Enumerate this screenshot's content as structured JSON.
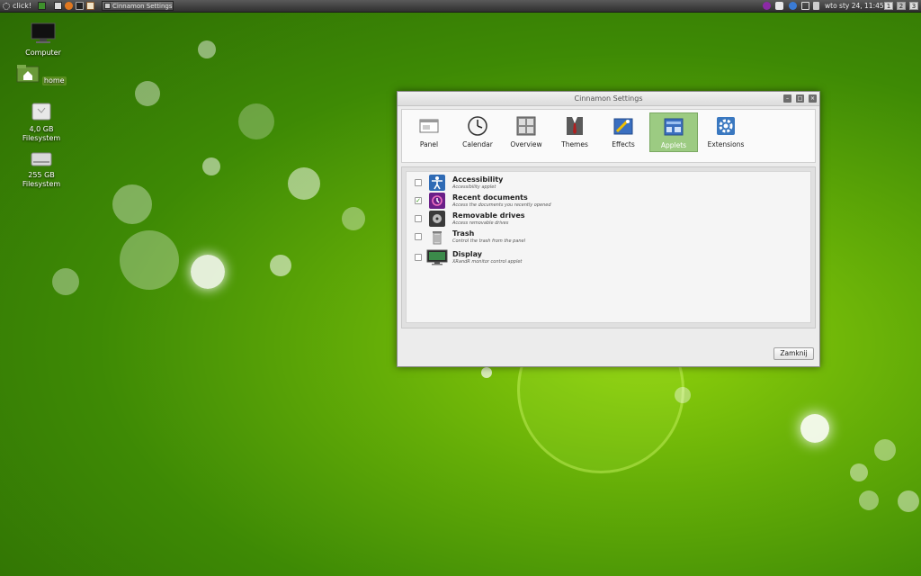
{
  "panel": {
    "menu_label": "click!",
    "taskbar_window": "Cinnamon Settings",
    "clock": "wto sty 24, 11:45",
    "workspaces": [
      "1",
      "2",
      "3"
    ],
    "active_workspace": "2"
  },
  "desktop": {
    "icons": [
      {
        "label": "Computer",
        "icon": "monitor-icon"
      },
      {
        "label": "home",
        "icon": "home-folder-icon"
      },
      {
        "label": "4,0 GB Filesystem",
        "icon": "drive-icon"
      },
      {
        "label": "255 GB Filesystem",
        "icon": "drive-icon"
      }
    ]
  },
  "window": {
    "title": "Cinnamon Settings",
    "tabs": [
      {
        "label": "Panel",
        "icon": "panel-icon"
      },
      {
        "label": "Calendar",
        "icon": "clock-icon"
      },
      {
        "label": "Overview",
        "icon": "overview-icon"
      },
      {
        "label": "Themes",
        "icon": "themes-icon"
      },
      {
        "label": "Effects",
        "icon": "effects-icon"
      },
      {
        "label": "Applets",
        "icon": "applets-icon"
      },
      {
        "label": "Extensions",
        "icon": "extensions-icon"
      }
    ],
    "active_tab": "Applets",
    "applets": [
      {
        "name": "Accessibility",
        "description": "Accessibility applet",
        "checked": false,
        "icon": "accessibility-icon"
      },
      {
        "name": "Recent documents",
        "description": "Access the documents you recently opened",
        "checked": true,
        "icon": "recent-documents-icon"
      },
      {
        "name": "Removable drives",
        "description": "Access removable drives",
        "checked": false,
        "icon": "removable-drive-icon"
      },
      {
        "name": "Trash",
        "description": "Control the trash from the panel",
        "checked": false,
        "icon": "trash-icon"
      },
      {
        "name": "Display",
        "description": "XRandR monitor control applet",
        "checked": false,
        "icon": "display-icon"
      }
    ],
    "close_label": "Zamknij"
  }
}
